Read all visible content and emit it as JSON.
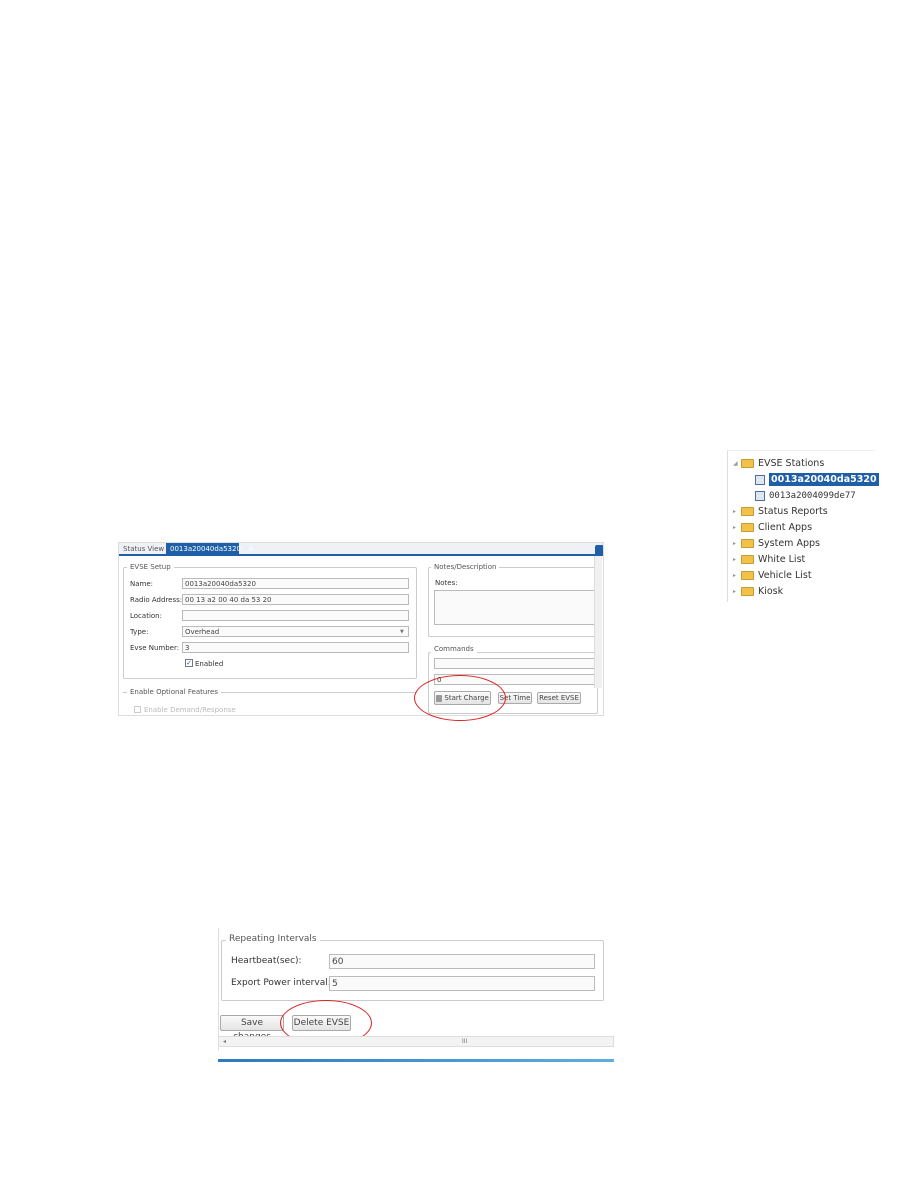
{
  "status_view": {
    "tabs": [
      {
        "label": "Status View",
        "active": false
      },
      {
        "label": "0013a20040da5320",
        "active": true,
        "close": "×"
      }
    ],
    "evse_setup": {
      "legend": "EVSE Setup",
      "fields": [
        {
          "label": "Name:",
          "value": "0013a20040da5320"
        },
        {
          "label": "Radio Address:",
          "value": "00 13 a2 00 40 da 53 20"
        },
        {
          "label": "Location:",
          "value": ""
        },
        {
          "label": "Type:",
          "value": "Overhead"
        },
        {
          "label": "Evse Number:",
          "value": "3"
        }
      ],
      "enabled_label": "Enabled",
      "enabled": true
    },
    "optional": {
      "legend": "Enable Optional Features",
      "demand_response_label": "Enable Demand/Response"
    },
    "notes": {
      "legend": "Notes/Description",
      "label": "Notes:",
      "value": ""
    },
    "commands": {
      "legend": "Commands",
      "input1": "",
      "input2": "0",
      "buttons": {
        "start_charge": "Start Charge",
        "set_time": "Set Time",
        "reset_evse": "Reset EVSE"
      }
    },
    "accent": "#1f5fa8",
    "highlight_color": "#dd2222"
  },
  "tree": {
    "root": "EVSE Stations",
    "stations": [
      {
        "label": "0013a20040da5320",
        "selected": true
      },
      {
        "label": "0013a2004099de77",
        "selected": false
      }
    ],
    "folders": [
      "Status Reports",
      "Client Apps",
      "System Apps",
      "White List",
      "Vehicle List",
      "Kiosk"
    ]
  },
  "intervals": {
    "legend": "Repeating Intervals",
    "heartbeat_label": "Heartbeat(sec):",
    "heartbeat_value": "60",
    "export_label": "Export Power interval:",
    "export_value": "5",
    "save_label": "Save changes",
    "delete_label": "Delete EVSE",
    "scroll_grip": "III",
    "scroll_left": "◂"
  }
}
